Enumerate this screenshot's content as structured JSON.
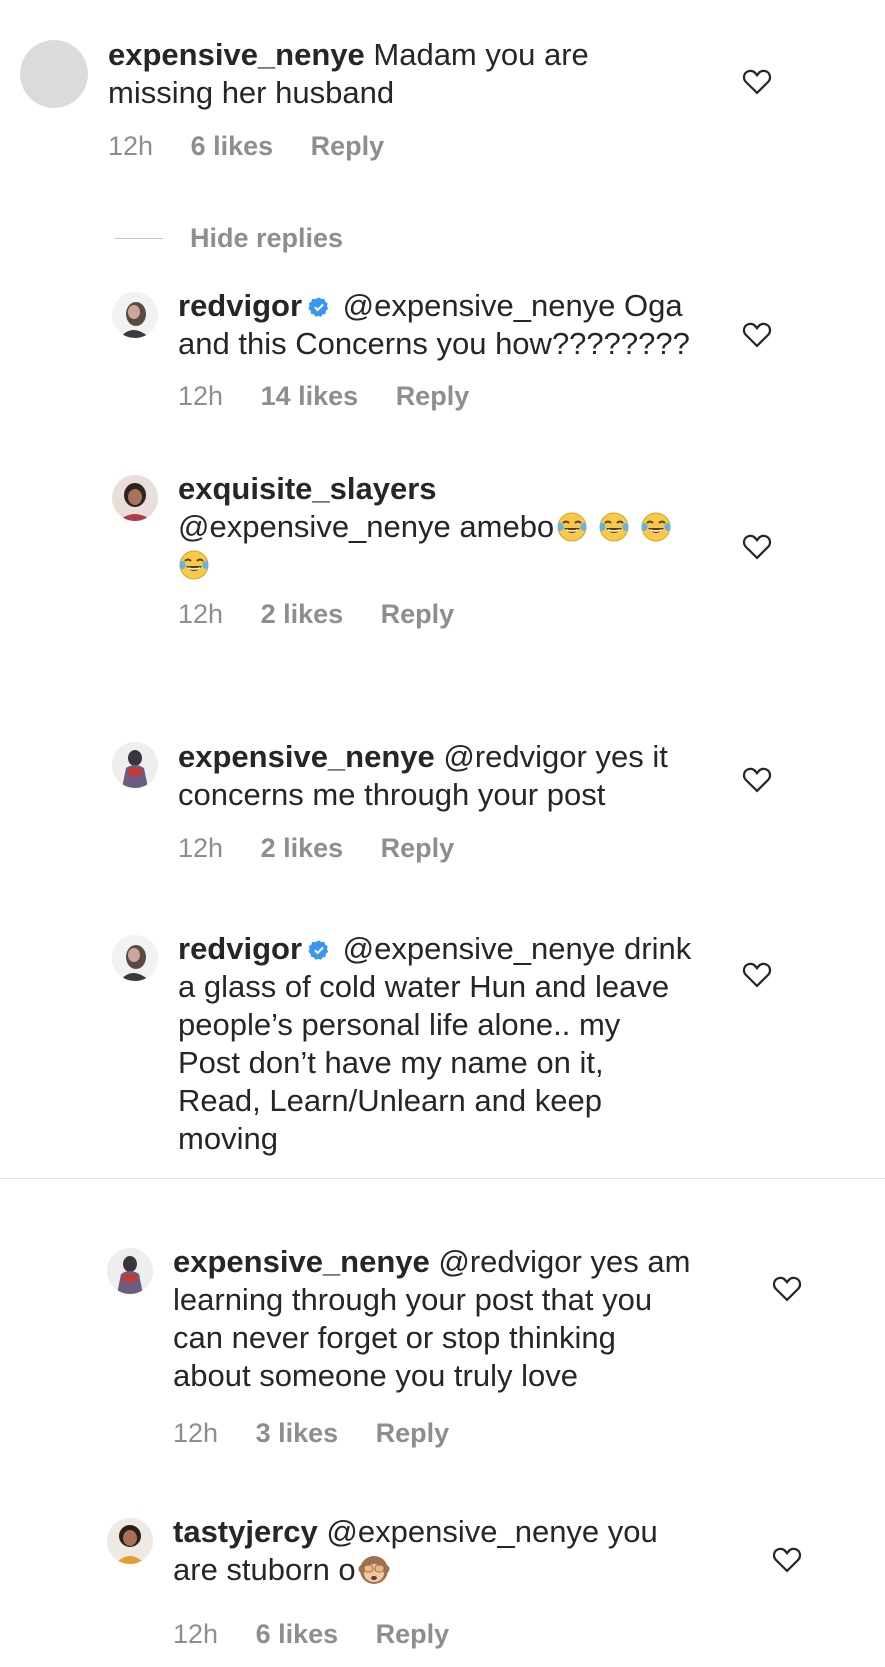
{
  "comments": [
    {
      "username": "expensive_nenye",
      "verified": false,
      "mention": "",
      "lines": [
        "Madam you are",
        "missing her husband"
      ],
      "time": "12h",
      "likes": "6 likes",
      "reply": "Reply",
      "avatar": "empty-avatar"
    },
    {
      "username": "redvigor",
      "verified": true,
      "mention": "@expensive_nenye",
      "lines": [
        "Oga",
        "and this Concerns you how????????"
      ],
      "time": "12h",
      "likes": "14 likes",
      "reply": "Reply",
      "avatar": "photo-avatar"
    },
    {
      "username": "exquisite_slayers",
      "verified": false,
      "mention": "@expensive_nenye",
      "lines": [
        "amebo"
      ],
      "emoji": "face-with-tears-of-joy",
      "time": "12h",
      "likes": "2 likes",
      "reply": "Reply",
      "avatar": "photo-avatar"
    },
    {
      "username": "expensive_nenye",
      "verified": false,
      "mention": "@redvigor",
      "lines": [
        "yes it",
        "concerns me through your post"
      ],
      "time": "12h",
      "likes": "2 likes",
      "reply": "Reply",
      "avatar": "photo-avatar"
    },
    {
      "username": "redvigor",
      "verified": true,
      "mention": "@expensive_nenye",
      "lines": [
        "drink",
        "a glass of cold water Hun and leave",
        "people’s personal life alone.. my",
        "Post don’t have my name on it,",
        "Read, Learn/Unlearn and keep",
        "moving"
      ],
      "avatar": "photo-avatar"
    },
    {
      "username": "expensive_nenye",
      "verified": false,
      "mention": "@redvigor",
      "lines": [
        "yes am",
        "learning through your post that you",
        "can never forget or stop thinking",
        "about someone you truly love"
      ],
      "time": "12h",
      "likes": "3 likes",
      "reply": "Reply",
      "avatar": "photo-avatar"
    },
    {
      "username": "tastyjercy",
      "verified": false,
      "mention": "@expensive_nenye",
      "lines": [
        "you",
        "are stuborn o"
      ],
      "emoji": "see-no-evil-monkey",
      "time": "12h",
      "likes": "6 likes",
      "reply": "Reply",
      "avatar": "photo-avatar"
    }
  ],
  "hide_replies_label": "Hide replies",
  "colors": {
    "text": "#262626",
    "secondary": "#8e8e8e",
    "verified": "#3897f0",
    "divider": "#e0e0e0"
  }
}
